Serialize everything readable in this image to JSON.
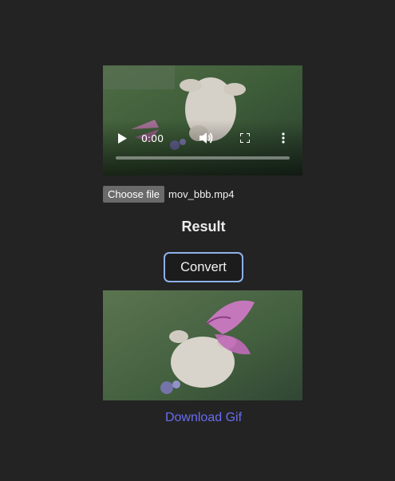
{
  "video_player": {
    "current_time": "0:00",
    "progress": 0
  },
  "file_input": {
    "button_label": "Choose file",
    "file_name": "mov_bbb.mp4"
  },
  "result": {
    "title": "Result",
    "convert_label": "Convert",
    "download_label": "Download Gif"
  },
  "colors": {
    "page_background": "#232323",
    "convert_border": "#8fb0ea",
    "link": "#6a6cf2"
  },
  "icons": [
    "play-icon",
    "volume-icon",
    "fullscreen-icon",
    "more-options-icon"
  ]
}
